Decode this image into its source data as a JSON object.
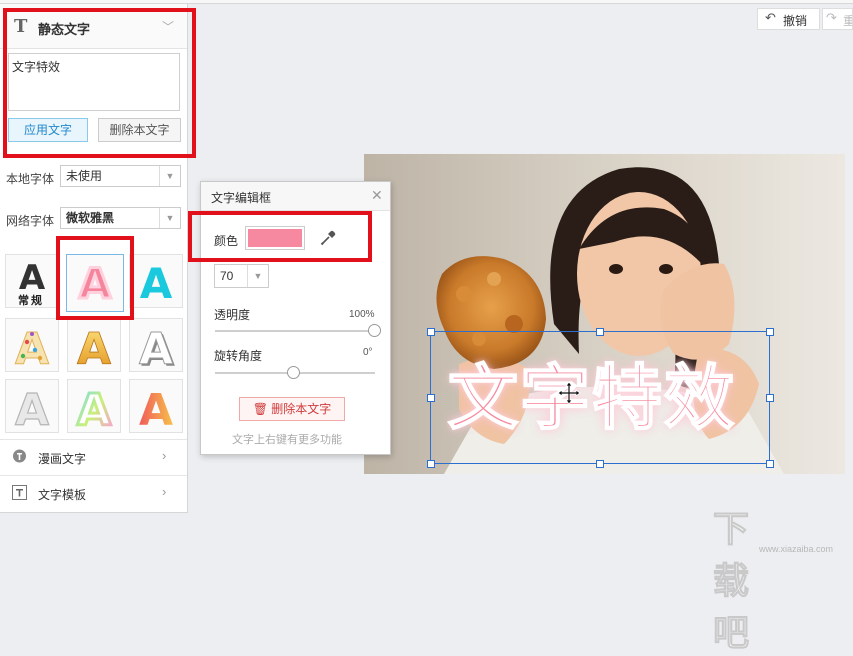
{
  "left_panel": {
    "header_title": "静态文字",
    "text_value": "文字特效",
    "apply_button": "应用文字",
    "delete_button": "删除本文字",
    "local_font_label": "本地字体",
    "local_font_value": "未使用",
    "web_font_label": "网络字体",
    "web_font_value": "微软雅黑",
    "styles": [
      {
        "label": "常规"
      }
    ],
    "menu": [
      {
        "label": "漫画文字",
        "icon": "comic-text-icon"
      },
      {
        "label": "文字模板",
        "icon": "text-template-icon"
      }
    ]
  },
  "toolbar": {
    "undo_label": "撤销",
    "redo_label": "重"
  },
  "dialog": {
    "title": "文字编辑框",
    "color_label": "颜色",
    "color_value": "#f6899f",
    "font_size": "70",
    "opacity_label": "透明度",
    "opacity_value": "100%",
    "opacity_level": 1.0,
    "rotation_label": "旋转角度",
    "rotation_value": "0°",
    "delete_button": "删除本文字",
    "hint": "文字上右键有更多功能"
  },
  "canvas": {
    "overlay_text": "文字特效"
  },
  "watermark": {
    "logo": "下载吧",
    "url": "www.xiazaiba.com"
  },
  "colors": {
    "highlight_red": "#e2101a",
    "selection_blue": "#2d6fce",
    "accent_pink": "#f6899f"
  }
}
